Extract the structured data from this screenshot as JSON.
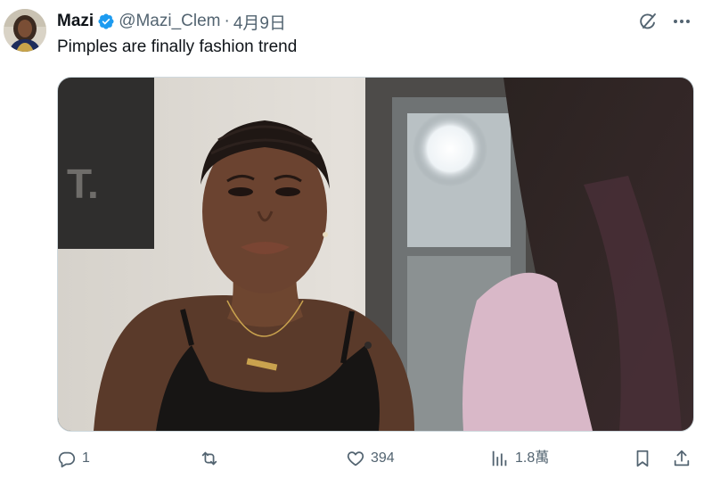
{
  "tweet": {
    "author": {
      "display_name": "Mazi",
      "handle": "@Mazi_Clem",
      "verified": true
    },
    "separator": "·",
    "date": "4月9日",
    "text": "Pimples are finally fashion trend"
  },
  "metrics": {
    "replies": "1",
    "likes": "394",
    "views": "1.8萬"
  },
  "icons": {
    "top": [
      "grok-icon",
      "more-icon"
    ],
    "actions": [
      "reply-icon",
      "retweet-icon",
      "like-icon",
      "views-icon",
      "bookmark-icon",
      "share-icon"
    ]
  },
  "colors": {
    "text_primary": "#0f1419",
    "text_secondary": "#536471",
    "verified_badge": "#1d9bf0",
    "border": "#cfd9de"
  }
}
